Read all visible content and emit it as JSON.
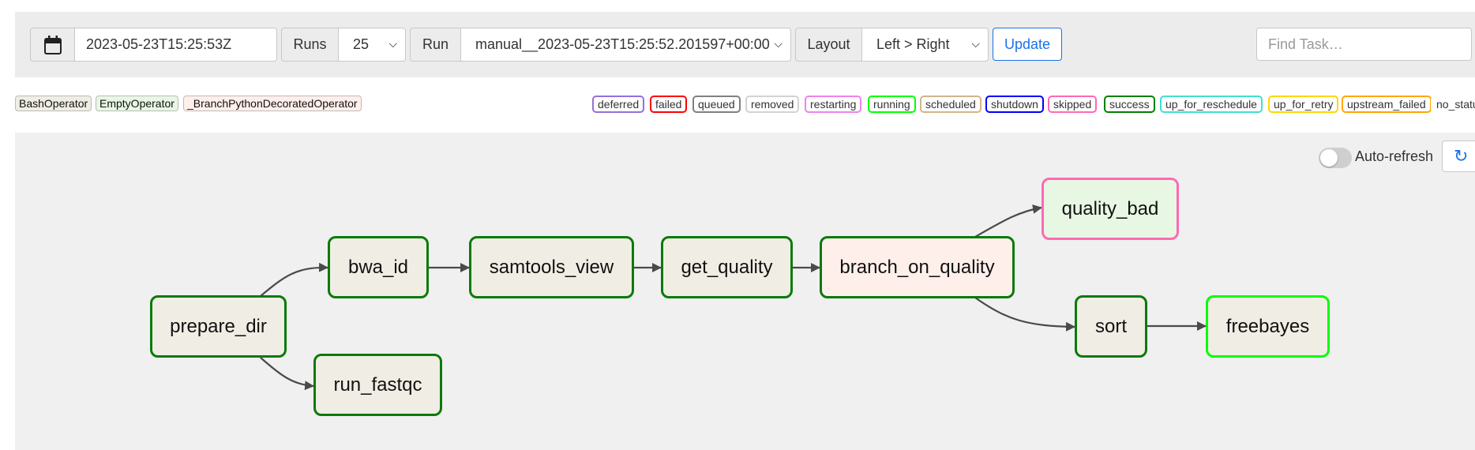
{
  "toolbar": {
    "datetime_value": "2023-05-23T15:25:53Z",
    "runs_label": "Runs",
    "runs_value": "25",
    "run_label": "Run",
    "run_value": "manual__2023-05-23T15:25:52.201597+00:00",
    "layout_label": "Layout",
    "layout_value": "Left > Right",
    "update_label": "Update",
    "find_placeholder": "Find Task…"
  },
  "legend": {
    "operators": [
      {
        "label": "BashOperator",
        "color": "#f0ede4"
      },
      {
        "label": "EmptyOperator",
        "color": "#e8f7e4"
      },
      {
        "label": "_BranchPythonDecoratedOperator",
        "color": "#ffefeb"
      }
    ],
    "states": [
      {
        "label": "deferred",
        "color": "#9370db"
      },
      {
        "label": "failed",
        "color": "#ff0000"
      },
      {
        "label": "queued",
        "color": "#808080"
      },
      {
        "label": "removed",
        "color": "#d3d3d3"
      },
      {
        "label": "restarting",
        "color": "#ee82ee"
      },
      {
        "label": "running",
        "color": "#00ff00"
      },
      {
        "label": "scheduled",
        "color": "#d2b48c"
      },
      {
        "label": "shutdown",
        "color": "#0000ff"
      },
      {
        "label": "skipped",
        "color": "#ff69b4"
      },
      {
        "label": "success",
        "color": "#008000"
      },
      {
        "label": "up_for_reschedule",
        "color": "#40e0d0"
      },
      {
        "label": "up_for_retry",
        "color": "#ffd700"
      },
      {
        "label": "upstream_failed",
        "color": "#ffa500"
      },
      {
        "label": "no_status",
        "color": "#ffffff"
      }
    ]
  },
  "graph": {
    "auto_refresh_label": "Auto-refresh",
    "nodes": {
      "prepare_dir": "prepare_dir",
      "bwa_id": "bwa_id",
      "run_fastqc": "run_fastqc",
      "samtools_view": "samtools_view",
      "get_quality": "get_quality",
      "branch_on_quality": "branch_on_quality",
      "quality_bad": "quality_bad",
      "sort": "sort",
      "freebayes": "freebayes"
    }
  }
}
